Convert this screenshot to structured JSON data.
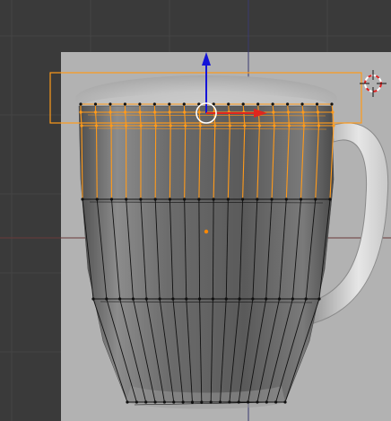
{
  "viewport": {
    "mode": "edit-mode",
    "selection": "top-edge-loop-selected",
    "colors": {
      "background": "#3a3a3a",
      "grid": "#444444",
      "x_axis": "#6a3a3a",
      "y_axis": "#3b3b6e",
      "reference_image_bg": "#b2b2b2",
      "mesh_wire": "#111111",
      "selected": "#ff9a1a",
      "gizmo_x": "#e0261e",
      "gizmo_z": "#1414d8",
      "pivot": "#ff8800"
    },
    "icons": {
      "manipulator": "transform-manipulator-icon",
      "cursor": "3d-cursor-icon",
      "pivot": "median-point-icon"
    }
  }
}
